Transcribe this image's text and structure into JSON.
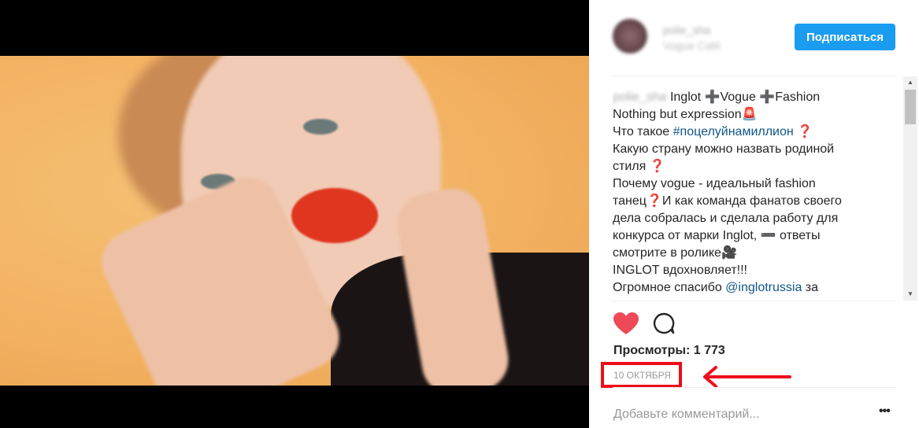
{
  "header": {
    "username": "polie_sha",
    "location": "Vogue Café",
    "follow_label": "Подписаться"
  },
  "caption": {
    "username": "polie_sha",
    "lines": [
      "Inglot ➕Vogue ➕Fashion",
      "Nothing but expression🚨",
      "Что такое ",
      "#поцелуйнамиллион",
      "❓",
      "Какую страну можно назвать родиной",
      "стиля ❓",
      "Почему vogue - идеальный fashion",
      "танец❓И как команда фанатов своего",
      "дела собралась и сделала работу для",
      "конкурса от марки Inglot, ➖ ответы",
      "смотрите в ролике🎥",
      "INGLOT вдохновляет!!!",
      "Огромное спасибо ",
      "@inglotrussia",
      " за"
    ]
  },
  "actions": {
    "like_icon": "heart-icon",
    "comment_icon": "comment-icon"
  },
  "stats": {
    "views": "Просмотры: 1 773",
    "date": "10 ОКТЯБРЯ"
  },
  "comment": {
    "placeholder": "Добавьте комментарий...",
    "more": "•••"
  },
  "colors": {
    "accent": "#1a9cf0",
    "like": "#ed4956",
    "annotation": "#ee0d1b"
  }
}
